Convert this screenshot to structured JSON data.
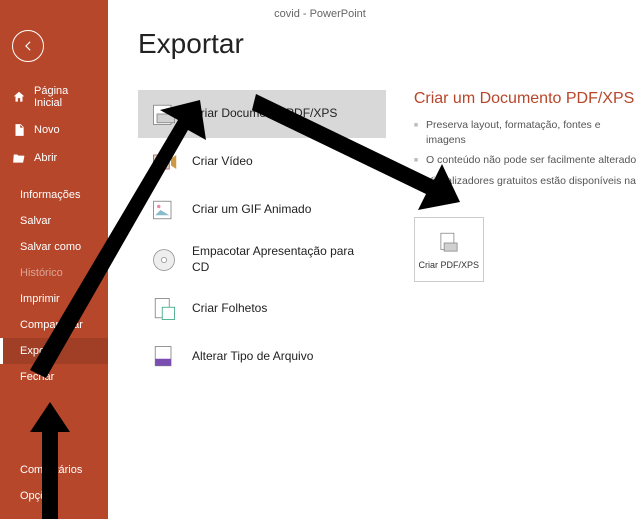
{
  "app": {
    "title": "covid  -  PowerPoint"
  },
  "sidebar": {
    "back_label": "Voltar",
    "home": "Página Inicial",
    "new": "Novo",
    "open": "Abrir",
    "info": "Informações",
    "save": "Salvar",
    "save_as": "Salvar como",
    "history": "Histórico",
    "print": "Imprimir",
    "share": "Compartilhar",
    "export": "Exportar",
    "close": "Fechar",
    "comments": "Comentários",
    "options": "Opções"
  },
  "page": {
    "title": "Exportar"
  },
  "options": {
    "pdf": "Criar Documento PDF/XPS",
    "video": "Criar Vídeo",
    "gif": "Criar um GIF Animado",
    "cd": "Empacotar Apresentação para CD",
    "handouts": "Criar Folhetos",
    "filetype": "Alterar Tipo de Arquivo"
  },
  "detail": {
    "title": "Criar um Documento PDF/XPS",
    "bullets": [
      "Preserva layout, formatação, fontes e imagens",
      "O conteúdo não pode ser facilmente alterado",
      "Visualizadores gratuitos estão disponíveis na Web"
    ],
    "action_label": "Criar PDF/XPS"
  }
}
